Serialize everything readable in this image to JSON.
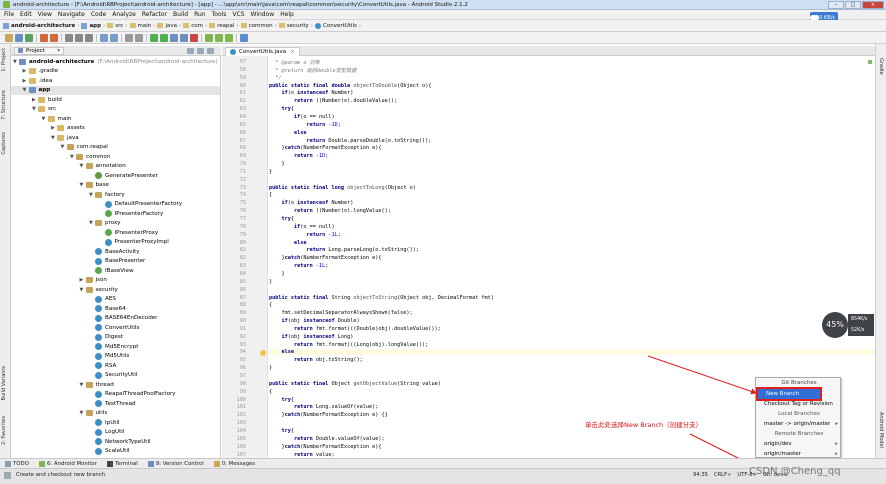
{
  "window": {
    "title": "android-architecture - [F:\\Android\\RBProject\\android-architecture] - [app] - ...\\app\\src\\main\\java\\com\\reapal\\common\\security\\ConvertUtils.java - Android Studio 2.1.2",
    "controls": [
      "–",
      "□",
      "×"
    ]
  },
  "menu": [
    "File",
    "Edit",
    "View",
    "Navigate",
    "Code",
    "Analyze",
    "Refactor",
    "Build",
    "Run",
    "Tools",
    "VCS",
    "Window",
    "Help"
  ],
  "net_speed": "450 KB/s",
  "breadcrumbs": [
    "android-architecture",
    "app",
    "src",
    "main",
    "java",
    "com",
    "reapal",
    "common",
    "security",
    "ConvertUtils"
  ],
  "side_left": [
    "1: Project",
    "7: Structure",
    "Captures",
    "Build Variants",
    "2: Favorites"
  ],
  "side_right": [
    "Gradle",
    "Android Model"
  ],
  "project_panel": {
    "selector": "Project"
  },
  "tree": [
    {
      "label": "android-architecture",
      "hint": "(F:\\Android\\RBProject\\android-architecture)",
      "icon": "mod",
      "depth": 0,
      "arrow": "▼",
      "bold": true
    },
    {
      "label": ".gradle",
      "icon": "folder",
      "depth": 1,
      "arrow": "▶"
    },
    {
      "label": ".idea",
      "icon": "folder",
      "depth": 1,
      "arrow": "▶"
    },
    {
      "label": "app",
      "icon": "mod",
      "depth": 1,
      "arrow": "▼",
      "bold": true,
      "selected": true
    },
    {
      "label": "build",
      "icon": "folder",
      "depth": 2,
      "arrow": "▶"
    },
    {
      "label": "src",
      "icon": "folder",
      "depth": 2,
      "arrow": "▼"
    },
    {
      "label": "main",
      "icon": "folder",
      "depth": 3,
      "arrow": "▼"
    },
    {
      "label": "assets",
      "icon": "folder",
      "depth": 4,
      "arrow": "▶"
    },
    {
      "label": "java",
      "icon": "folder",
      "depth": 4,
      "arrow": "▼"
    },
    {
      "label": "com.reapal",
      "icon": "pkg",
      "depth": 5,
      "arrow": "▼"
    },
    {
      "label": "common",
      "icon": "pkg",
      "depth": 6,
      "arrow": "▼"
    },
    {
      "label": "annotation",
      "icon": "pkg",
      "depth": 7,
      "arrow": "▼"
    },
    {
      "label": "GeneratePresenter",
      "icon": "annot",
      "depth": 8,
      "arrow": ""
    },
    {
      "label": "base",
      "icon": "pkg",
      "depth": 7,
      "arrow": "▼"
    },
    {
      "label": "factory",
      "icon": "pkg",
      "depth": 8,
      "arrow": "▼"
    },
    {
      "label": "DefaultPresenterFactory",
      "icon": "cls",
      "depth": 9,
      "arrow": ""
    },
    {
      "label": "IPresenterFactory",
      "icon": "iface",
      "depth": 9,
      "arrow": ""
    },
    {
      "label": "proxy",
      "icon": "pkg",
      "depth": 8,
      "arrow": "▼"
    },
    {
      "label": "IPresenterProxy",
      "icon": "iface",
      "depth": 9,
      "arrow": ""
    },
    {
      "label": "PresenterProxyImpl",
      "icon": "cls",
      "depth": 9,
      "arrow": ""
    },
    {
      "label": "BaseActivity",
      "icon": "cls",
      "depth": 8,
      "arrow": ""
    },
    {
      "label": "BasePresenter",
      "icon": "cls",
      "depth": 8,
      "arrow": ""
    },
    {
      "label": "IBaseView",
      "icon": "iface",
      "depth": 8,
      "arrow": ""
    },
    {
      "label": "json",
      "icon": "pkg",
      "depth": 7,
      "arrow": "▶"
    },
    {
      "label": "security",
      "icon": "pkg",
      "depth": 7,
      "arrow": "▼"
    },
    {
      "label": "AES",
      "icon": "cls",
      "depth": 8,
      "arrow": ""
    },
    {
      "label": "Base64",
      "icon": "cls",
      "depth": 8,
      "arrow": ""
    },
    {
      "label": "BASE64EnDecoder",
      "icon": "cls",
      "depth": 8,
      "arrow": ""
    },
    {
      "label": "ConvertUtils",
      "icon": "cls",
      "depth": 8,
      "arrow": ""
    },
    {
      "label": "Digest",
      "icon": "cls",
      "depth": 8,
      "arrow": ""
    },
    {
      "label": "Md5Encrypt",
      "icon": "cls",
      "depth": 8,
      "arrow": ""
    },
    {
      "label": "Md5Utils",
      "icon": "cls",
      "depth": 8,
      "arrow": ""
    },
    {
      "label": "RSA",
      "icon": "cls",
      "depth": 8,
      "arrow": ""
    },
    {
      "label": "SecurityUtil",
      "icon": "cls",
      "depth": 8,
      "arrow": ""
    },
    {
      "label": "thread",
      "icon": "pkg",
      "depth": 7,
      "arrow": "▼"
    },
    {
      "label": "ReapalThreadPoolFactory",
      "icon": "cls",
      "depth": 8,
      "arrow": ""
    },
    {
      "label": "TestThread",
      "icon": "cls",
      "depth": 8,
      "arrow": ""
    },
    {
      "label": "utils",
      "icon": "pkg",
      "depth": 7,
      "arrow": "▼"
    },
    {
      "label": "IpUtil",
      "icon": "cls",
      "depth": 8,
      "arrow": ""
    },
    {
      "label": "LogUtil",
      "icon": "cls",
      "depth": 8,
      "arrow": ""
    },
    {
      "label": "NetworkTypeUtil",
      "icon": "cls",
      "depth": 8,
      "arrow": ""
    },
    {
      "label": "ScaleUtil",
      "icon": "cls",
      "depth": 8,
      "arrow": ""
    }
  ],
  "editor_tab": "ConvertUtils.java",
  "first_line_number": 57,
  "highlight_line": 94,
  "bulb_line": 94,
  "code": [
    "  * @param o 对象",
    "  * @return 返回double类型数据",
    "  */",
    "public static final double objectToDouble(Object o){",
    "    if(o instanceof Number)",
    "        return ((Number)o).doubleValue();",
    "    try{",
    "        if(o == null)",
    "            return -1D;",
    "        else",
    "            return Double.parseDouble(o.toString());",
    "    }catch(NumberFormatException e){",
    "        return -1D;",
    "    }",
    "}",
    "",
    "public static final long objectToLong(Object o)",
    "{",
    "    if(o instanceof Number)",
    "        return ((Number)o).longValue();",
    "    try{",
    "        if(o == null)",
    "            return -1L;",
    "        else",
    "            return Long.parseLong(o.toString());",
    "    }catch(NumberFormatException e){",
    "        return -1L;",
    "    }",
    "}",
    "",
    "public static final String objectToString(Object obj, DecimalFormat fmt)",
    "{",
    "    fmt.setDecimalSeparatorAlwaysShown(false);",
    "    if(obj instanceof Double)",
    "        return fmt.format(((Double)obj).doubleValue());",
    "    if(obj instanceof Long)",
    "        return fmt.format(((Long)obj).longValue());",
    "    else",
    "        return obj.toString();",
    "}",
    "",
    "public static final Object getObjectValue(String value)",
    "{",
    "    try{",
    "        return Long.valueOf(value);",
    "    }catch(NumberFormatException e) {}",
    "",
    "    try{",
    "        return Double.valueOf(value);",
    "    }catch(NumberFormatException e){",
    "        return value;"
  ],
  "perf_widget": {
    "percent": "45%",
    "up": "654K/s",
    "down": "52K/s"
  },
  "git_popup": {
    "title": "Git Branches",
    "new_branch": "New Branch",
    "checkout": "Checkout Tag or Revision",
    "local_header": "Local Branches",
    "local": [
      {
        "name": "master -> origin/master",
        "sub": "▸"
      }
    ],
    "remote_header": "Remote Branches",
    "remote": [
      {
        "name": "origin/dev",
        "sub": "▸"
      },
      {
        "name": "origin/master",
        "sub": "▸"
      }
    ]
  },
  "annotation_note": "单击此处选择New Branch（创建分支）",
  "bottom_tabs": [
    "TODO",
    "6: Android Monitor",
    "Terminal",
    "9: Version Control",
    "0: Messages"
  ],
  "status": {
    "message": "Create and checkout new branch",
    "position": "94:35",
    "line_sep": "CRLF÷",
    "encoding": "UTF-8÷",
    "branch": "Git: dev÷"
  },
  "watermark": "CSDN @Cheng_qq",
  "colors": {
    "accent": "#2f6fd6",
    "annotation": "#e0201d",
    "titlebar": "#cfe0f3"
  }
}
